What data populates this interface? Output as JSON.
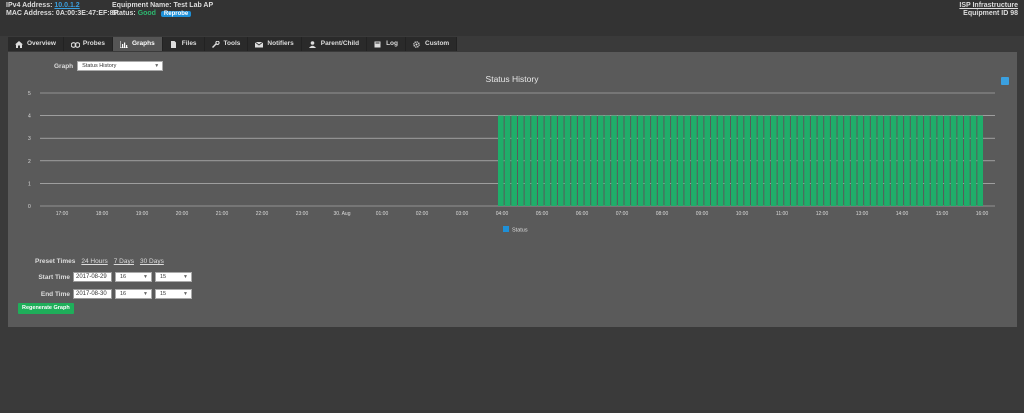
{
  "header": {
    "ipv4_label": "IPv4 Address:",
    "ipv4_value": "10.0.1.2",
    "mac_label": "MAC Address:",
    "mac_value": "0A:00:3E:47:EF:8F",
    "equip_name_label": "Equipment Name:",
    "equip_name_value": "Test Lab AP",
    "status_label": "Status:",
    "status_value": "Good",
    "badge": "Reprobe",
    "isp_link": "ISP Infrastructure",
    "equipment_id": "Equipment ID 98"
  },
  "tabs": [
    {
      "label": "Overview",
      "icon": "home-icon"
    },
    {
      "label": "Probes",
      "icon": "probes-icon"
    },
    {
      "label": "Graphs",
      "icon": "graph-icon",
      "active": true
    },
    {
      "label": "Files",
      "icon": "file-icon"
    },
    {
      "label": "Tools",
      "icon": "wrench-icon"
    },
    {
      "label": "Notifiers",
      "icon": "envelope-icon"
    },
    {
      "label": "Parent/Child",
      "icon": "user-icon"
    },
    {
      "label": "Log",
      "icon": "book-icon"
    },
    {
      "label": "Custom",
      "icon": "gear-icon"
    }
  ],
  "graph_select": {
    "label": "Graph",
    "value": "Status History"
  },
  "colors": {
    "accent": "#1e90d8",
    "good": "#2db870",
    "bar": "#1fae6a"
  },
  "chart_data": {
    "type": "bar",
    "title": "Status History",
    "ylim": [
      0,
      5
    ],
    "yticks": [
      "0",
      "1",
      "2",
      "3",
      "4",
      "5"
    ],
    "xticks": [
      "17:00",
      "18:00",
      "19:00",
      "20:00",
      "21:00",
      "22:00",
      "23:00",
      "30. Aug",
      "01:00",
      "02:00",
      "03:00",
      "04:00",
      "05:00",
      "06:00",
      "07:00",
      "08:00",
      "09:00",
      "10:00",
      "11:00",
      "12:00",
      "13:00",
      "14:00",
      "15:00",
      "16:00"
    ],
    "series": [
      {
        "name": "Status",
        "value": 4,
        "start_hour": 10.9,
        "end_hour": 23.05
      }
    ],
    "legend": "bottom-center",
    "grid": true
  },
  "preset": {
    "label": "Preset Times",
    "options": [
      "24 Hours",
      "7 Days",
      "30 Days"
    ]
  },
  "start": {
    "label": "Start Time",
    "date": "2017-08-29",
    "hour": "16",
    "minute": "15"
  },
  "end": {
    "label": "End Time",
    "date": "2017-08-30",
    "hour": "16",
    "minute": "15"
  },
  "button": "Regenerate Graph"
}
